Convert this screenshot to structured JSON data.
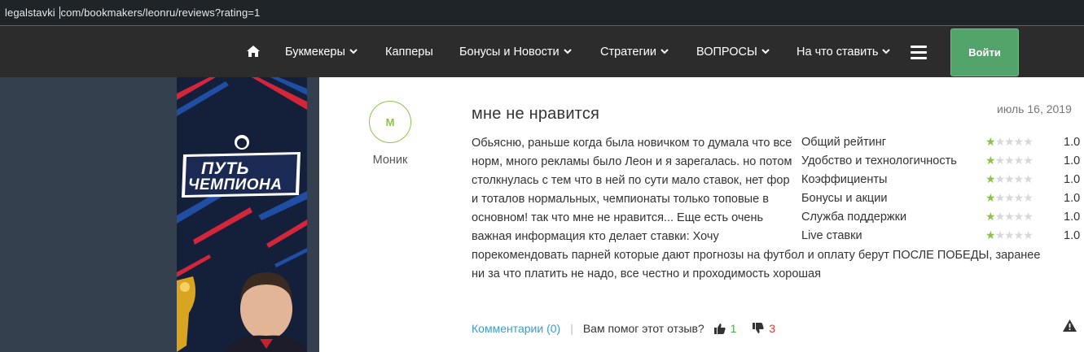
{
  "browser": {
    "url_before_caret": "legalstavki ",
    "url_after_caret": "com/bookmakers/leonru/reviews?rating=1"
  },
  "nav": {
    "home_icon": "home-icon",
    "items": [
      {
        "label": "Букмекеры",
        "has_dropdown": true
      },
      {
        "label": "Капперы",
        "has_dropdown": false
      },
      {
        "label": "Бонусы и Новости",
        "has_dropdown": true
      },
      {
        "label": "Стратегии",
        "has_dropdown": true
      },
      {
        "label": "ВОПРОСЫ",
        "has_dropdown": true
      },
      {
        "label": "На что ставить",
        "has_dropdown": true
      }
    ],
    "menu_icon": "hamburger-icon",
    "login_label": "Войти",
    "login_color": "#52a46b"
  },
  "banner": {
    "line1": "ПУТЬ",
    "line2": "ЧЕМПИОНА"
  },
  "review": {
    "avatar_letter": "М",
    "author": "Моник",
    "title": "мне не нравится",
    "date": "июль 16, 2019",
    "text_part1": "Обьясню, раньше когда была новичком то думала что все норм, много рекламы было Леон и я зарегалась. но потом столкнулась с тем что в ней по сути мало ставок, нет фор и тоталов нормальных, чемпионаты только топовые в основном! так что мне не нравится... Еще есть очень важная информация кто делает ставки: Хочу",
    "text_part2": "порекомендовать парней которые дают прогнозы на футбол и оплату берут ПОСЛЕ ПОБЕДЫ, заранее ни за что платить не надо, все честно и проходимость хорошая",
    "ratings": [
      {
        "label": "Общий рейтинг",
        "stars": 1,
        "value": "1.0"
      },
      {
        "label": "Удобство и технологичность",
        "stars": 1,
        "value": "1.0"
      },
      {
        "label": "Коэффициенты",
        "stars": 1,
        "value": "1.0"
      },
      {
        "label": "Бонусы и акции",
        "stars": 1,
        "value": "1.0"
      },
      {
        "label": "Служба поддержки",
        "stars": 1,
        "value": "1.0"
      },
      {
        "label": "Live ставки",
        "stars": 1,
        "value": "1.0"
      }
    ],
    "comments_label": "Комментарии (0)",
    "helpful_label": "Вам помог этот отзыв?",
    "likes": "1",
    "dislikes": "3",
    "star_color": "#8bc34a"
  }
}
